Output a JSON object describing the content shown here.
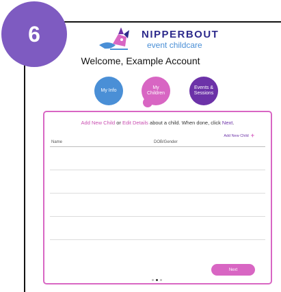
{
  "step_badge": "6",
  "logo": {
    "title": "NIPPERBOUT",
    "subtitle": "event childcare"
  },
  "welcome": "Welcome, Example Account",
  "nav": {
    "my_info": "My Info",
    "my_children": "My Children",
    "events_sessions": "Events & Sessions"
  },
  "panel": {
    "instructions": {
      "add": "Add New Child",
      "or": " or ",
      "edit": "Edit Details",
      "mid": " about a child. When done, click ",
      "next": "Next",
      "end": "."
    },
    "add_link": "Add New Child",
    "columns": {
      "name": "Name",
      "dob_gender": "DOB/Gender"
    },
    "next_button": "Next"
  },
  "pager": {
    "pages": 3,
    "current": 2
  },
  "colors": {
    "badge": "#7e5bc1",
    "accent_pink": "#d866c3",
    "accent_blue": "#4a8fd6",
    "accent_purple": "#6c32a8",
    "brand_navy": "#2d2a8c"
  }
}
